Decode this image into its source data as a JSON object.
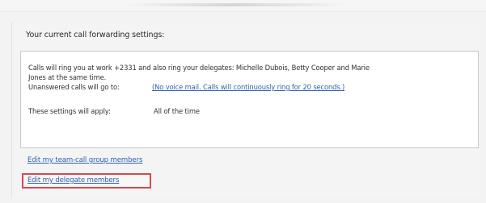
{
  "heading": "Your current call forwarding settings:",
  "settings": {
    "line1": "Calls will ring you at work +2331 and also ring your delegates: Michelle Dubois, Betty Cooper and Marie",
    "line2": "Jones at the same time.",
    "unanswered_label": "Unanswered calls will go to:",
    "unanswered_link": "(No voice mail. Calls will continuously ring for 20 seconds.)",
    "apply_label": "These settings will apply:",
    "apply_value": "All of the time"
  },
  "links": {
    "team_call": "Edit my team-call group members",
    "delegate": "Edit my delegate members"
  },
  "colors": {
    "link": "#2f62b0",
    "highlight": "#d54950"
  }
}
